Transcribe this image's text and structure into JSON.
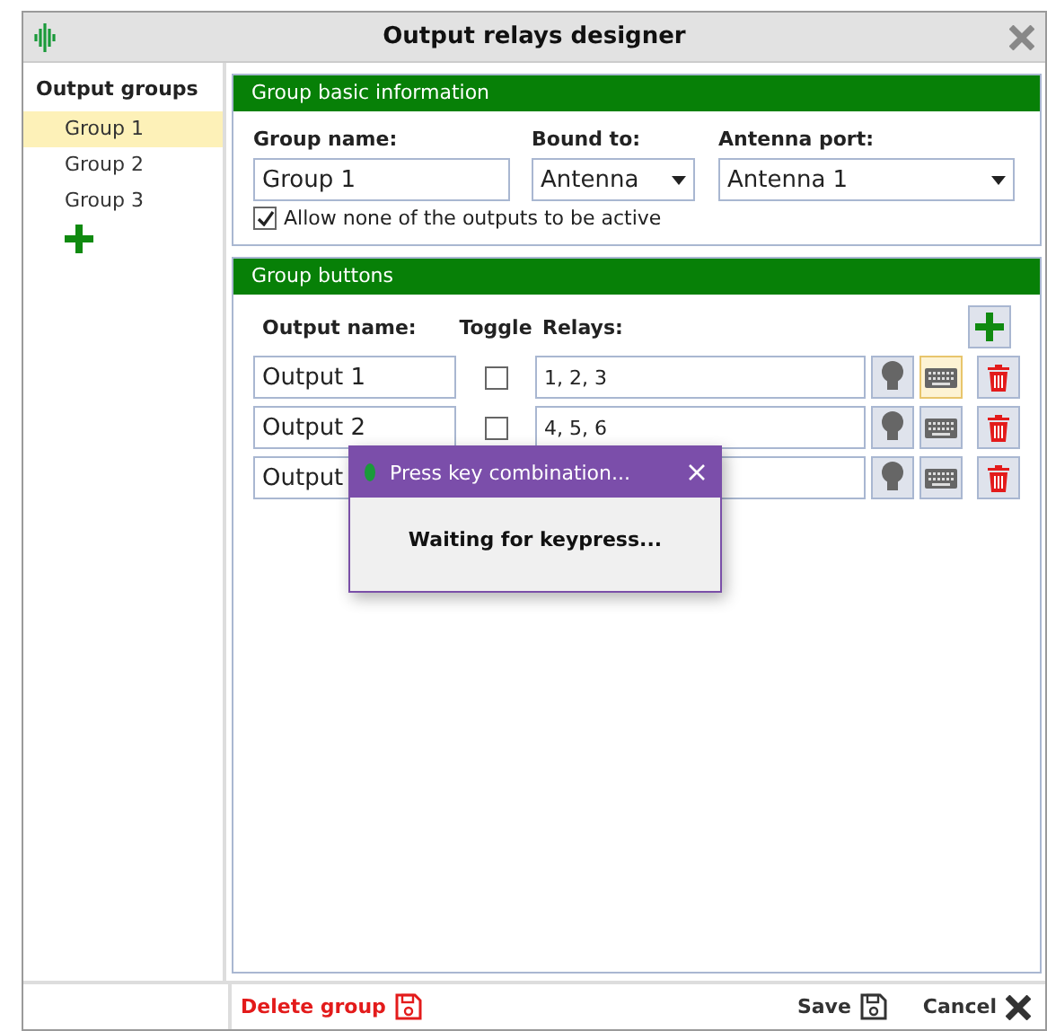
{
  "window": {
    "title": "Output relays designer"
  },
  "sidebar": {
    "title": "Output groups",
    "items": [
      {
        "label": "Group 1",
        "selected": true
      },
      {
        "label": "Group 2",
        "selected": false
      },
      {
        "label": "Group 3",
        "selected": false
      }
    ]
  },
  "basic_info": {
    "title": "Group basic information",
    "group_name_label": "Group name:",
    "group_name": "Group 1",
    "bound_to_label": "Bound to:",
    "bound_to": "Antenna",
    "antenna_port_label": "Antenna port:",
    "antenna_port": "Antenna 1",
    "allow_none": {
      "label": "Allow none of the outputs to be active",
      "checked": true
    }
  },
  "buttons_section": {
    "title": "Group buttons",
    "columns": [
      "Output name:",
      "Toggle",
      "Relays:"
    ],
    "rows": [
      {
        "name": "Output 1",
        "toggle": false,
        "relays": "1, 2, 3",
        "keyboard_selected": true
      },
      {
        "name": "Output 2",
        "toggle": false,
        "relays": "4, 5, 6",
        "keyboard_selected": false
      },
      {
        "name": "Output",
        "keyboard_selected": false
      }
    ]
  },
  "dialog": {
    "title": "Press key combination...",
    "message": "Waiting for keypress..."
  },
  "footer": {
    "delete": "Delete group",
    "save": "Save",
    "cancel": "Cancel"
  }
}
